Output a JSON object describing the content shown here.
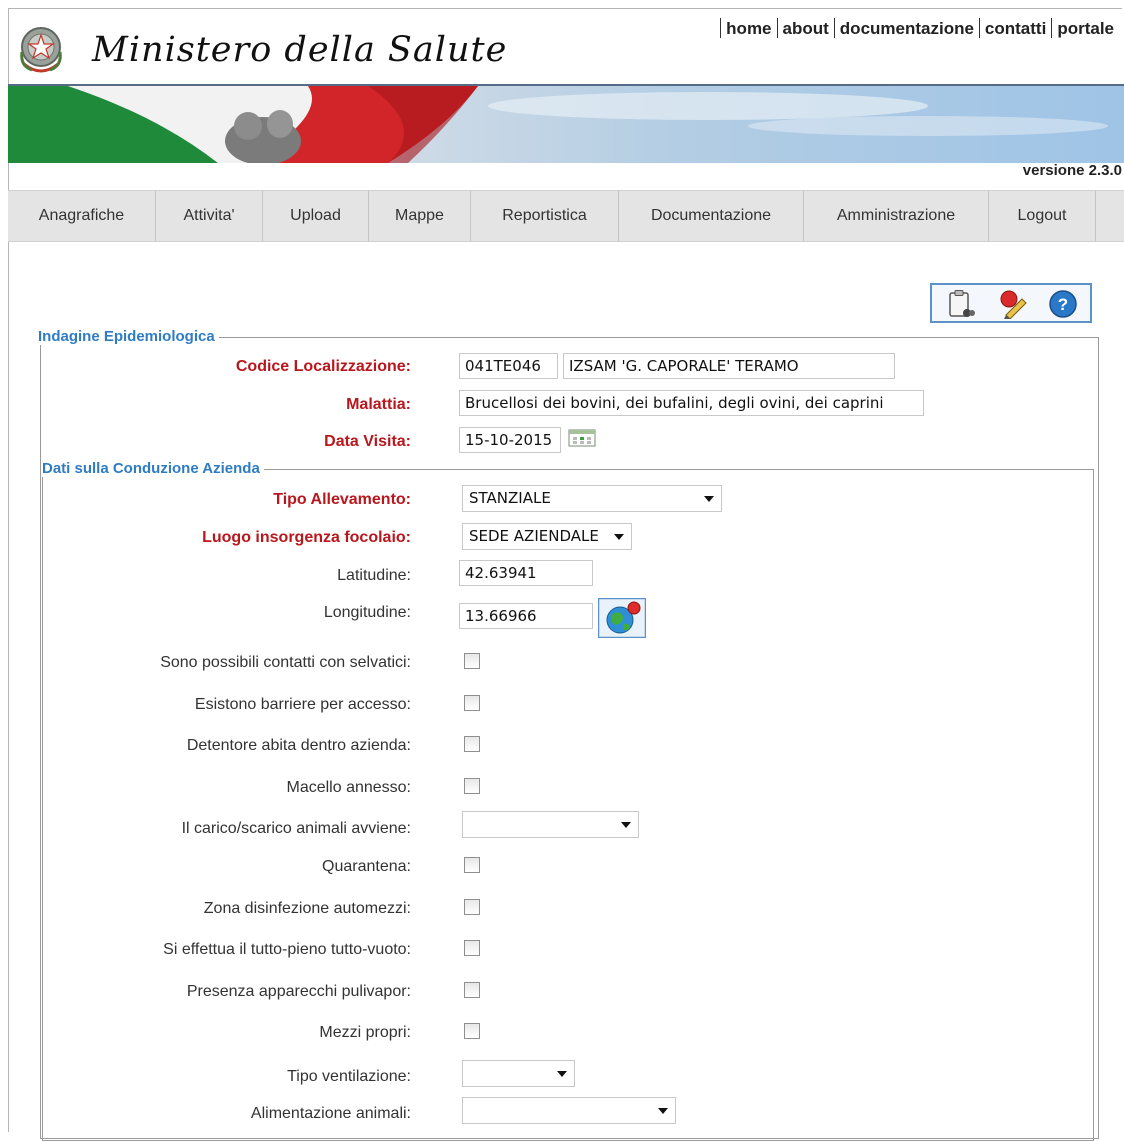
{
  "header": {
    "ministry_title": "Ministero della Salute",
    "links": [
      "home",
      "about",
      "documentazione",
      "contatti",
      "portale"
    ],
    "version": "versione 2.3.0"
  },
  "menu": [
    "Anagrafiche",
    "Attivita'",
    "Upload",
    "Mappe",
    "Reportistica",
    "Documentazione",
    "Amministrazione",
    "Logout"
  ],
  "toolbar": {
    "icons": [
      "clipboard-icon",
      "edit-icon",
      "help-icon"
    ],
    "help_glyph": "?"
  },
  "section_indagine": {
    "legend": "Indagine Epidemiologica",
    "codice_label": "Codice Localizzazione:",
    "codice_value": "041TE046",
    "codice_name": "IZSAM 'G. CAPORALE' TERAMO",
    "malattia_label": "Malattia:",
    "malattia_value": "Brucellosi dei bovini, dei bufalini, degli ovini, dei caprini",
    "data_label": "Data Visita:",
    "data_value": "15-10-2015"
  },
  "section_conduzione": {
    "legend": "Dati sulla Conduzione Azienda",
    "tipo_allevamento_label": "Tipo Allevamento:",
    "tipo_allevamento_value": "STANZIALE",
    "luogo_label": "Luogo insorgenza focolaio:",
    "luogo_value": "SEDE AZIENDALE",
    "latitudine_label": "Latitudine:",
    "latitudine_value": "42.63941",
    "longitudine_label": "Longitudine:",
    "longitudine_value": "13.66966",
    "selvatici_label": "Sono possibili contatti con selvatici:",
    "barriere_label": "Esistono barriere per accesso:",
    "detentore_label": "Detentore abita dentro azienda:",
    "macello_label": "Macello annesso:",
    "carico_label": "Il carico/scarico animali avviene:",
    "carico_value": "",
    "quarantena_label": "Quarantena:",
    "disinfezione_label": "Zona disinfezione automezzi:",
    "tutto_pieno_label": "Si effettua il tutto-pieno tutto-vuoto:",
    "pulivapor_label": "Presenza apparecchi pulivapor:",
    "mezzi_label": "Mezzi propri:",
    "ventilazione_label": "Tipo ventilazione:",
    "ventilazione_value": "",
    "alimentazione_label": "Alimentazione animali:",
    "alimentazione_value": ""
  }
}
